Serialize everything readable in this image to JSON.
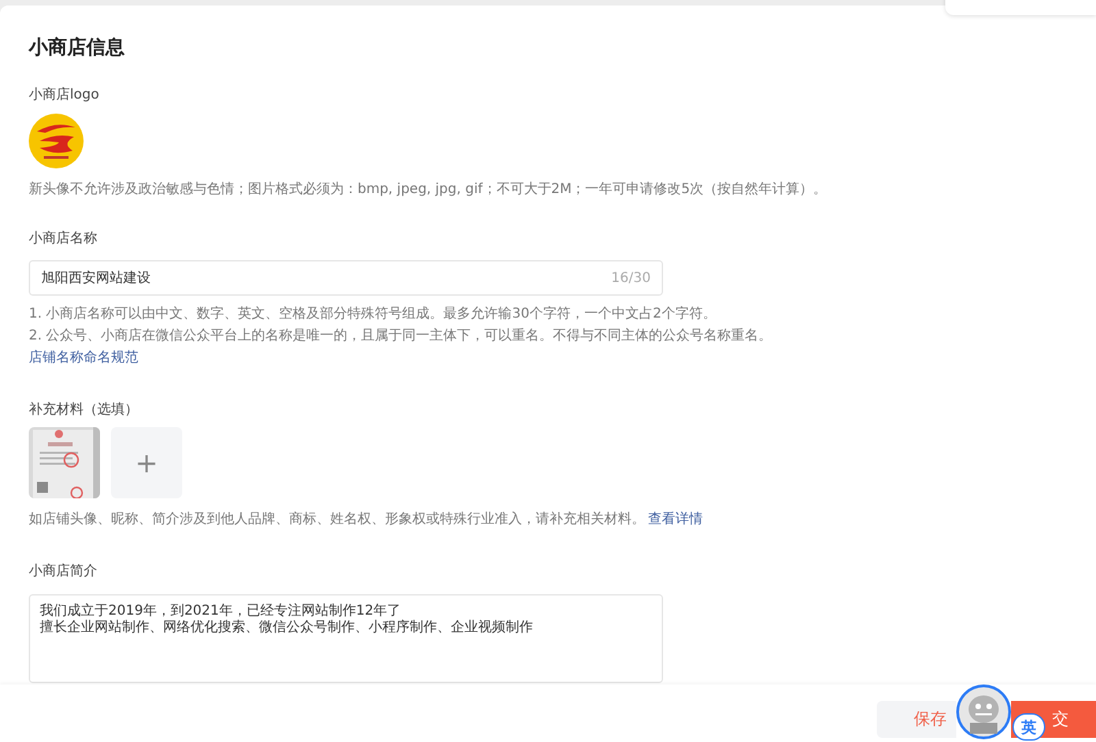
{
  "title": "小商店信息",
  "logo_section": {
    "label": "小商店logo",
    "hint": "新头像不允许涉及政治敏感与色情；图片格式必须为：bmp, jpeg, jpg, gif；不可大于2M；一年可申请修改5次（按自然年计算）。"
  },
  "name_section": {
    "label": "小商店名称",
    "value": "旭阳西安网站建设",
    "counter": "16/30",
    "rules": [
      "1. 小商店名称可以由中文、数字、英文、空格及部分特殊符号组成。最多允许输30个字符，一个中文占2个字符。",
      "2. 公众号、小商店在微信公众平台上的名称是唯一的，且属于同一主体下，可以重名。不得与不同主体的公众号名称重名。"
    ],
    "link": "店铺名称命名规范"
  },
  "materials_section": {
    "label": "补充材料（选填）",
    "add_icon": "+",
    "hint": "如店铺头像、昵称、简介涉及到他人品牌、商标、姓名权、形象权或特殊行业准入，请补充相关材料。",
    "link": "查看详情"
  },
  "intro_section": {
    "label": "小商店简介",
    "lines": [
      "我们成立于2019年，到2021年，已经专注网站制作12年了",
      "擅长企业网站制作、网络优化搜索、微信公众号制作、小程序制作、企业视频制作"
    ]
  },
  "footer": {
    "buttons": [
      {
        "label": "保存",
        "kind": "secondary"
      },
      {
        "label": "交",
        "kind": "primary"
      }
    ]
  },
  "ime_badge": {
    "label": "英"
  }
}
